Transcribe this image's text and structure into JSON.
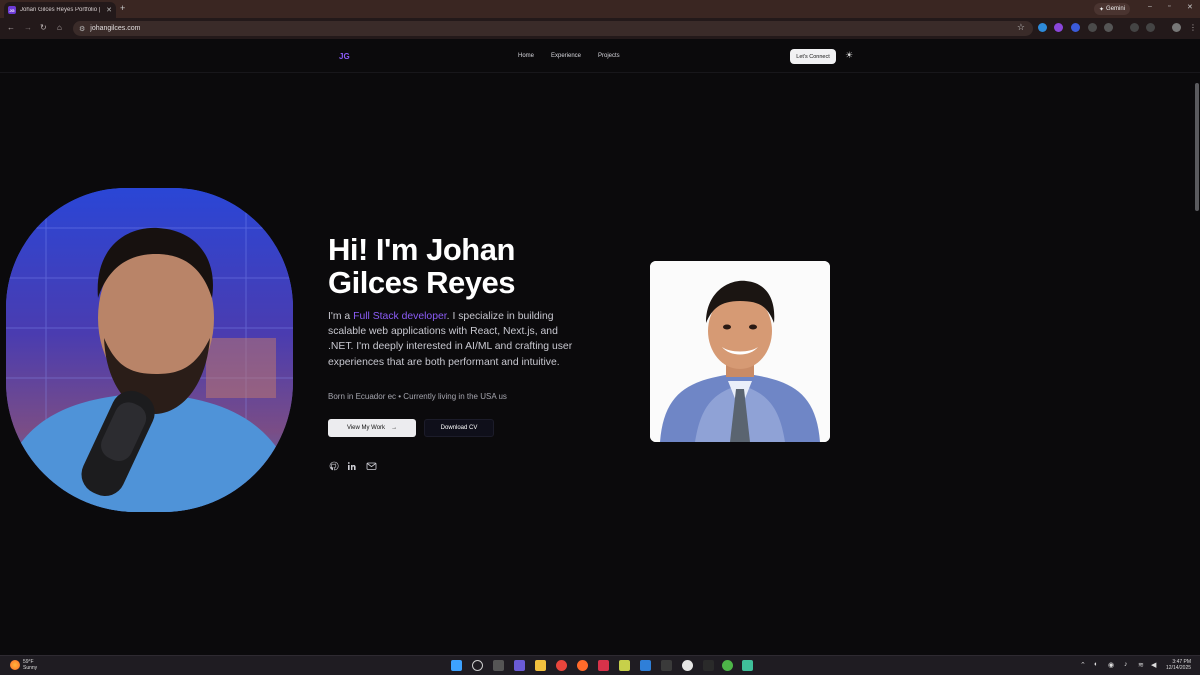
{
  "browser": {
    "tab_title": "Johan Gilces Reyes Portfolio | F",
    "tab_favicon_text": "JG",
    "gemini_label": "Gemini",
    "url": "johangilces.com"
  },
  "site": {
    "logo": "JG",
    "nav": [
      "Home",
      "Experience",
      "Projects"
    ],
    "connect_label": "Let's Connect"
  },
  "hero": {
    "title": "Hi! I'm Johan Gilces Reyes",
    "desc_prefix": "I'm a ",
    "desc_highlight": "Full Stack developer",
    "desc_rest": ". I specialize in building scalable web applications with React, Next.js, and .NET. I'm deeply interested in AI/ML and crafting user experiences that are both performant and intuitive.",
    "origin": "Born in Ecuador ec • Currently living in the USA us",
    "view_work": "View My Work",
    "download_cv": "Download CV"
  },
  "taskbar": {
    "weather_temp": "59°F",
    "weather_cond": "Sunny",
    "time": "3:47 PM",
    "date": "12/14/2025"
  },
  "colors": {
    "accent": "#8b5cf6",
    "background": "#0b0a0c"
  }
}
